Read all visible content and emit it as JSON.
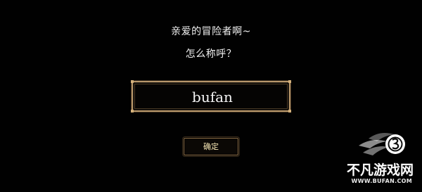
{
  "dialog": {
    "prompt_line1": "亲爱的冒险者啊~",
    "prompt_line2": "怎么称呼？",
    "name_value": "bufan",
    "confirm_label": "确定"
  },
  "watermark": {
    "title": "不凡游戏网",
    "url": "WWW.BUFAN.COM"
  },
  "colors": {
    "background": "#010101",
    "frame_gold": "#b8976a",
    "button_text": "#f6e6b4",
    "text": "#f2f2f2"
  }
}
